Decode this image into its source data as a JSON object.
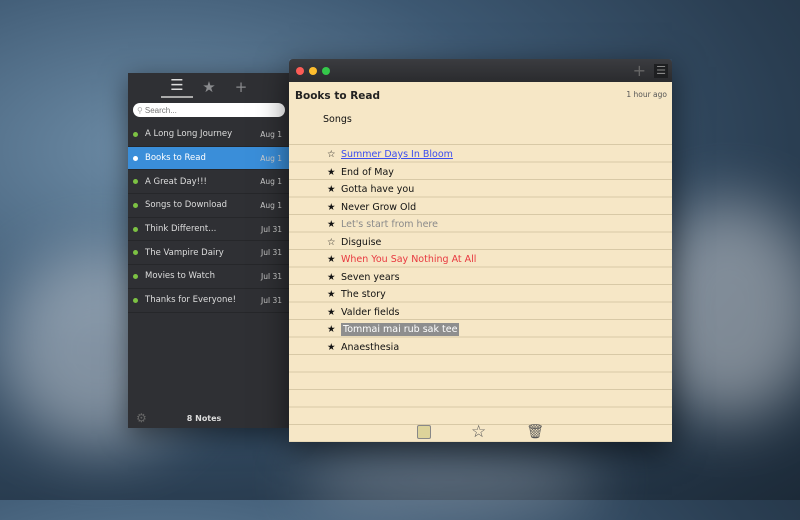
{
  "sidebar": {
    "search_placeholder": "Search...",
    "tabs": [
      "list-icon",
      "star-icon",
      "plus-icon"
    ],
    "count": "8 Notes",
    "notes": [
      {
        "title": "A Long Long Journey",
        "date": "Aug 1"
      },
      {
        "title": "Books to Read",
        "date": "Aug 1",
        "selected": true
      },
      {
        "title": "A Great Day!!!",
        "date": "Aug 1"
      },
      {
        "title": "Songs to Download",
        "date": "Aug 1"
      },
      {
        "title": "Think Different...",
        "date": "Jul 31"
      },
      {
        "title": "The Vampire Dairy",
        "date": "Jul 31"
      },
      {
        "title": "Movies to Watch",
        "date": "Jul 31"
      },
      {
        "title": "Thanks for Everyone!",
        "date": "Jul 31"
      }
    ]
  },
  "note": {
    "title": "Books to Read",
    "time": "1 hour ago",
    "heading": "Songs",
    "items": [
      {
        "star": "☆",
        "text": "Summer Days In Bloom",
        "style": "link"
      },
      {
        "star": "★",
        "text": "End of May"
      },
      {
        "star": "★",
        "text": "Gotta have you"
      },
      {
        "star": "★",
        "text": "Never Grow Old"
      },
      {
        "star": "★",
        "text": "Let's start from here",
        "style": "gray"
      },
      {
        "star": "☆",
        "text": "Disguise"
      },
      {
        "star": "★",
        "text": "When You Say Nothing At All",
        "style": "red"
      },
      {
        "star": "★",
        "text": "Seven years"
      },
      {
        "star": "★",
        "text": "The story"
      },
      {
        "star": "★",
        "text": "Valder fields"
      },
      {
        "star": "★",
        "text": "Tommai mai rub sak tee",
        "style": "highlight"
      },
      {
        "star": "★",
        "text": "Anaesthesia"
      }
    ]
  },
  "colors": {
    "link": "#3b4cf0",
    "red": "#e8383f",
    "gray": "#8a8a8a",
    "highlight": "#8e8e8e",
    "accent": "#3a8ed9"
  }
}
